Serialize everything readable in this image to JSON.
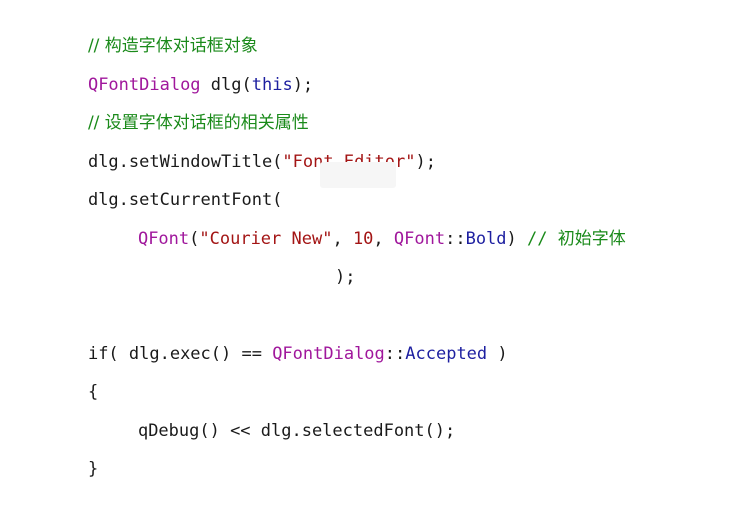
{
  "colors": {
    "comment": "#1a8a1a",
    "class": "#a0179c",
    "keyword": "#1d1fa0",
    "string": "#a31515",
    "plain": "#1a1a1a",
    "background": "#ffffff"
  },
  "lines": {
    "l1": {
      "comment": "// 构造字体对话框对象"
    },
    "l2": {
      "cls": "QFontDialog",
      "rest": " dlg(",
      "kw": "this",
      "end": ");"
    },
    "l3": {
      "comment": "// 设置字体对话框的相关属性"
    },
    "l4": {
      "pre": "dlg.setWindowTitle(",
      "str": "\"Font Editor\"",
      "end": ");"
    },
    "l5": {
      "text": "dlg.setCurrentFont("
    },
    "l6": {
      "cls1": "QFont",
      "p1": "(",
      "str": "\"Courier New\"",
      "p2": ", ",
      "num": "10",
      "p3": ", ",
      "cls2": "QFont",
      "p4": "::",
      "kw": "Bold",
      "p5": ") ",
      "comment_slashes": "// ",
      "comment_text": "初始字体"
    },
    "l7": {
      "text": ");"
    },
    "l8": {
      "pre": "if( dlg.exec() == ",
      "cls": "QFontDialog",
      "sep": "::",
      "kw": "Accepted",
      "end": " )"
    },
    "l9": {
      "text": "{"
    },
    "l10": {
      "text": "qDebug() << dlg.selectedFont();"
    },
    "l11": {
      "text": "}"
    }
  }
}
